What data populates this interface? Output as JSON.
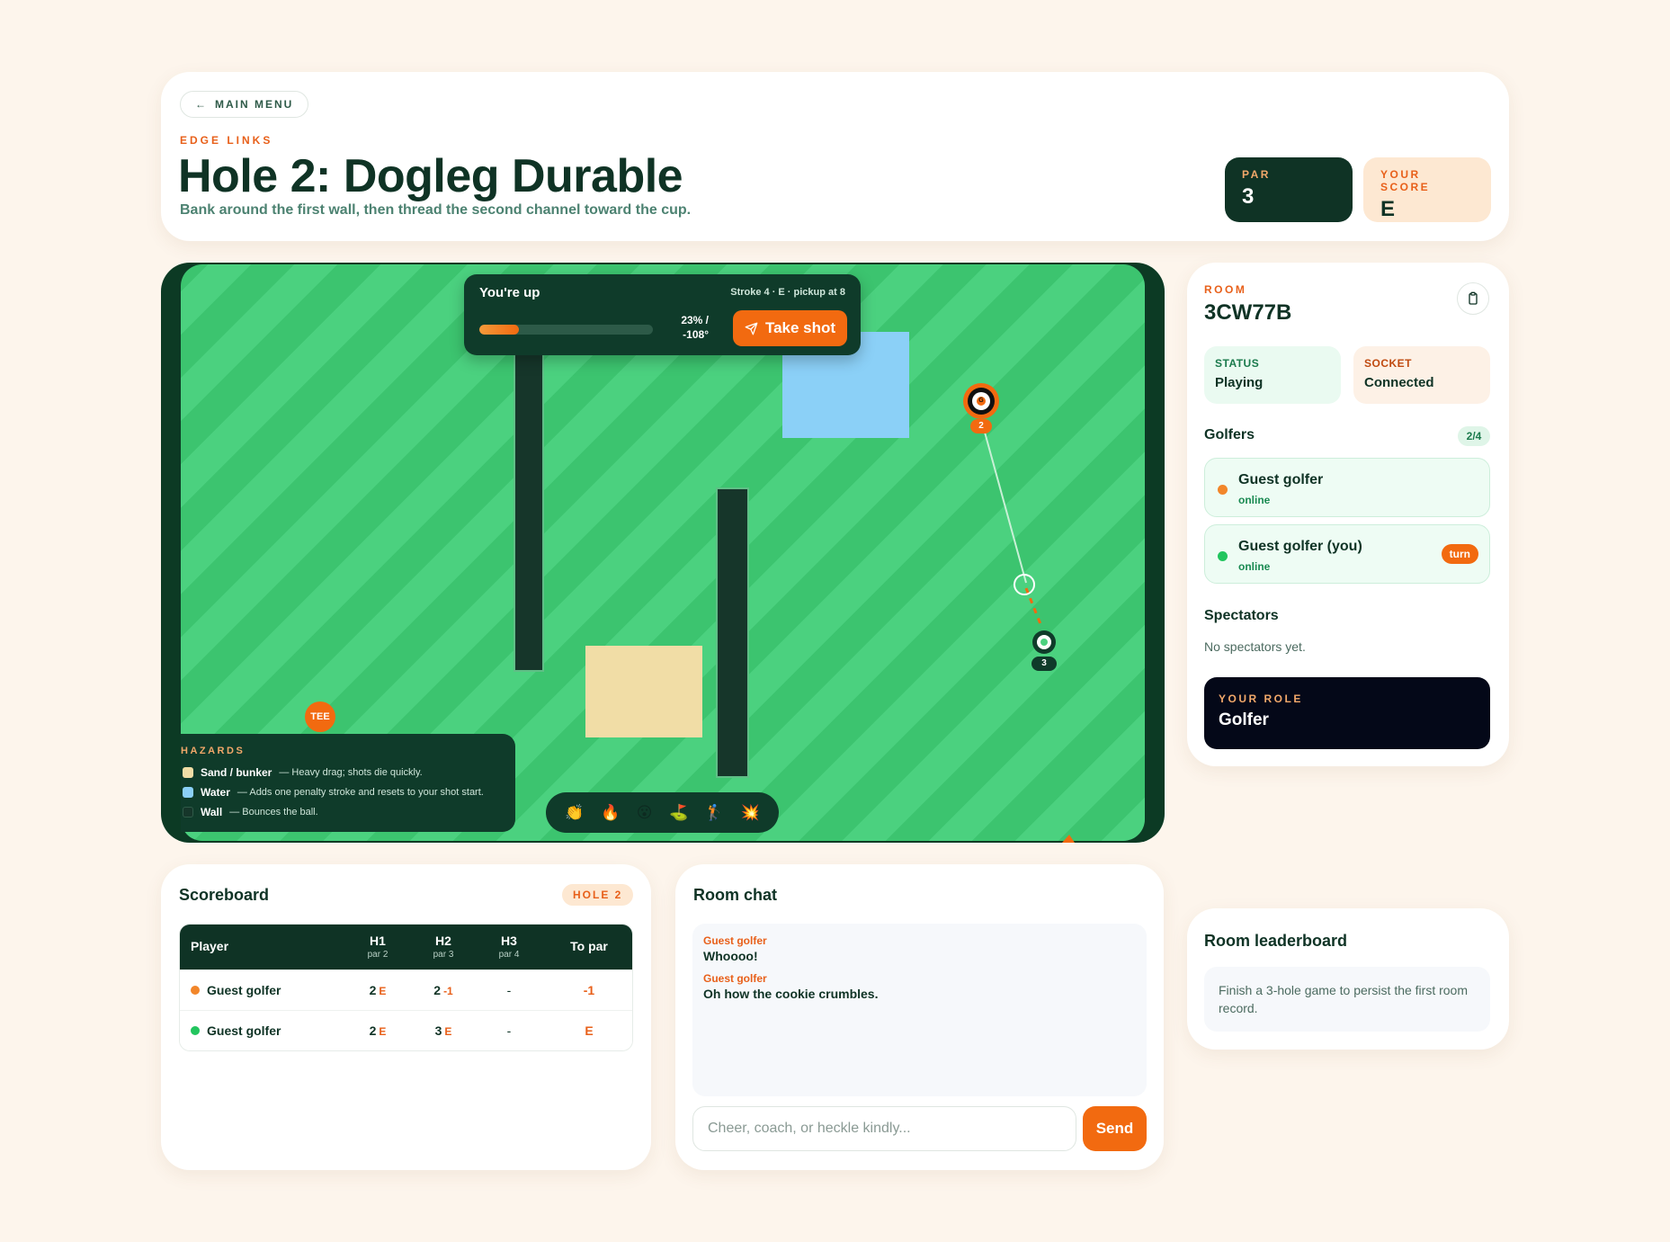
{
  "header": {
    "back_label": "MAIN MENU",
    "eyebrow": "EDGE LINKS",
    "title": "Hole 2: Dogleg Durable",
    "subtitle": "Bank around the first wall, then thread the second channel toward the cup.",
    "par_label": "PAR",
    "par_value": "3",
    "score_label": "YOUR SCORE",
    "score_value": "E"
  },
  "course": {
    "hud": {
      "title": "You're up",
      "meta": "Stroke 4 · E · pickup at 8",
      "power_percent": 23,
      "power_text": "23% /",
      "angle_text": "-108°",
      "shot_label": "Take shot"
    },
    "tee_label": "TEE",
    "ball_a_tag": "2",
    "ball_a_letter": "G",
    "ball_b_tag": "3",
    "hazards": {
      "heading": "HAZARDS",
      "items": [
        {
          "name": "Sand / bunker",
          "desc": "— Heavy drag; shots die quickly.",
          "color": "#f1dda6"
        },
        {
          "name": "Water",
          "desc": "— Adds one penalty stroke and resets to your shot start.",
          "color": "#8bd0f7"
        },
        {
          "name": "Wall",
          "desc": "— Bounces the ball.",
          "color": "#16362a"
        }
      ]
    },
    "reactions": [
      "👏",
      "🔥",
      "😮",
      "⛳",
      "🏌",
      "💥"
    ]
  },
  "room": {
    "label": "ROOM",
    "code": "3CW77B",
    "status_label": "STATUS",
    "status_value": "Playing",
    "socket_label": "SOCKET",
    "socket_value": "Connected",
    "golfers_title": "Golfers",
    "golfers_count": "2/4",
    "golfers": [
      {
        "name": "Guest golfer",
        "status": "online",
        "color": "#f2862a",
        "turn": ""
      },
      {
        "name": "Guest golfer (you)",
        "status": "online",
        "color": "#22c55e",
        "turn": "turn"
      }
    ],
    "spectators_title": "Spectators",
    "spectators_empty": "No spectators yet.",
    "role_label": "YOUR ROLE",
    "role_value": "Golfer"
  },
  "scoreboard": {
    "title": "Scoreboard",
    "badge": "HOLE 2",
    "columns": [
      {
        "label": "Player",
        "sub": ""
      },
      {
        "label": "H1",
        "sub": "par 2"
      },
      {
        "label": "H2",
        "sub": "par 3"
      },
      {
        "label": "H3",
        "sub": "par 4"
      },
      {
        "label": "To par",
        "sub": ""
      }
    ],
    "rows": [
      {
        "name": "Guest golfer",
        "color": "#f2862a",
        "h1": "2",
        "h1_rel": "E",
        "h2": "2",
        "h2_rel": "-1",
        "h3": "-",
        "to_par": "-1"
      },
      {
        "name": "Guest golfer",
        "color": "#22c55e",
        "h1": "2",
        "h1_rel": "E",
        "h2": "3",
        "h2_rel": "E",
        "h3": "-",
        "to_par": "E"
      }
    ]
  },
  "chat": {
    "title": "Room chat",
    "messages": [
      {
        "who": "Guest golfer",
        "text": "Whoooo!"
      },
      {
        "who": "Guest golfer",
        "text": "Oh how the cookie crumbles."
      }
    ],
    "placeholder": "Cheer, coach, or heckle kindly...",
    "send_label": "Send"
  },
  "leaderboard": {
    "title": "Room leaderboard",
    "note": "Finish a 3-hole game to persist the first room record."
  }
}
